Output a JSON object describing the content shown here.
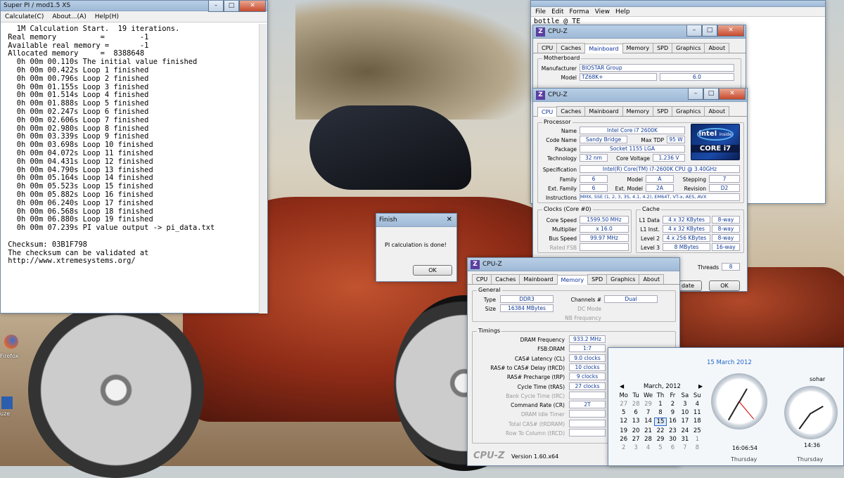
{
  "superpi": {
    "title": "Super PI / mod1.5 XS",
    "menu": [
      "Calculate(C)",
      "About...(A)",
      "Help(H)"
    ],
    "lines": [
      "   1M Calculation Start.  19 iterations.",
      " Real memory          =        -1",
      " Available real memory =       -1",
      " Allocated memory     =  8388648",
      "   0h 00m 00.110s The initial value finished",
      "   0h 00m 00.422s Loop 1 finished",
      "   0h 00m 00.796s Loop 2 finished",
      "   0h 00m 01.155s Loop 3 finished",
      "   0h 00m 01.514s Loop 4 finished",
      "   0h 00m 01.888s Loop 5 finished",
      "   0h 00m 02.247s Loop 6 finished",
      "   0h 00m 02.606s Loop 7 finished",
      "   0h 00m 02.980s Loop 8 finished",
      "   0h 00m 03.339s Loop 9 finished",
      "   0h 00m 03.698s Loop 10 finished",
      "   0h 00m 04.072s Loop 11 finished",
      "   0h 00m 04.431s Loop 12 finished",
      "   0h 00m 04.790s Loop 13 finished",
      "   0h 00m 05.164s Loop 14 finished",
      "   0h 00m 05.523s Loop 15 finished",
      "   0h 00m 05.882s Loop 16 finished",
      "   0h 00m 06.240s Loop 17 finished",
      "   0h 00m 06.568s Loop 18 finished",
      "   0h 00m 06.880s Loop 19 finished",
      "   0h 00m 07.239s PI value output -> pi_data.txt",
      "",
      " Checksum: 03B1F798",
      " The checksum can be validated at",
      " http://www.xtremesystems.org/"
    ]
  },
  "finish": {
    "title": "Finish",
    "message": "PI calculation is done!",
    "ok": "OK"
  },
  "notepad": {
    "menu": [
      "File",
      "Edit",
      "Forma",
      "View",
      "Help"
    ],
    "text": "bottle @ TE"
  },
  "cpuz_mb": {
    "title": "CPU-Z",
    "tabs": [
      "CPU",
      "Caches",
      "Mainboard",
      "Memory",
      "SPD",
      "Graphics",
      "About"
    ],
    "group": "Motherboard",
    "manufacturer_label": "Manufacturer",
    "manufacturer": "BIOSTAR Group",
    "model_label": "Model",
    "model": "TZ68K+",
    "model_rev": "6.0"
  },
  "cpuz_cpu": {
    "title": "CPU-Z",
    "tabs": [
      "CPU",
      "Caches",
      "Mainboard",
      "Memory",
      "SPD",
      "Graphics",
      "About"
    ],
    "processor": "Processor",
    "name_label": "Name",
    "name": "Intel Core i7 2600K",
    "codename_label": "Code Name",
    "codename": "Sandy Bridge",
    "tdp_label": "Max TDP",
    "tdp": "95 W",
    "package_label": "Package",
    "package": "Socket 1155 LGA",
    "tech_label": "Technology",
    "tech": "32 nm",
    "voltage_label": "Core Voltage",
    "voltage": "1.236 V",
    "spec_label": "Specification",
    "spec": "Intel(R) Core(TM) i7-2600K CPU @ 3.40GHz",
    "family_label": "Family",
    "family": "6",
    "model_label": "Model",
    "model": "A",
    "stepping_label": "Stepping",
    "stepping": "7",
    "extfamily_label": "Ext. Family",
    "extfamily": "6",
    "extmodel_label": "Ext. Model",
    "extmodel": "2A",
    "revision_label": "Revision",
    "revision": "D2",
    "instr_label": "Instructions",
    "instr": "MMX, SSE (1, 2, 3, 3S, 4.1, 4.2), EM64T, VT-x, AES, AVX",
    "clocks": "Clocks (Core #0)",
    "corespeed_label": "Core Speed",
    "corespeed": "1599.50 MHz",
    "mult_label": "Multiplier",
    "mult": "x 16.0",
    "bus_label": "Bus Speed",
    "bus": "99.97 MHz",
    "fsb_label": "Rated FSB",
    "cache": "Cache",
    "l1d_label": "L1 Data",
    "l1d": "4 x 32 KBytes",
    "l1d_way": "8-way",
    "l1i_label": "L1 Inst.",
    "l1i": "4 x 32 KBytes",
    "l1i_way": "8-way",
    "l2_label": "Level 2",
    "l2": "4 x 256 KBytes",
    "l2_way": "8-way",
    "l3_label": "Level 3",
    "l3": "8 MBytes",
    "l3_way": "16-way",
    "threads_label": "Threads",
    "threads": "8",
    "validate": "date",
    "ok": "OK",
    "logo_brand": "intel",
    "logo_inside": "inside",
    "logo_product": "CORE i7"
  },
  "cpuz_mem": {
    "title": "CPU-Z",
    "tabs": [
      "CPU",
      "Caches",
      "Mainboard",
      "Memory",
      "SPD",
      "Graphics",
      "About"
    ],
    "general": "General",
    "type_label": "Type",
    "type": "DDR3",
    "size_label": "Size",
    "size": "16384 MBytes",
    "channels_label": "Channels #",
    "channels": "Dual",
    "dcmode_label": "DC Mode",
    "nbfreq_label": "NB Frequency",
    "timings": "Timings",
    "rows": [
      {
        "label": "DRAM Frequency",
        "value": "933.2 MHz",
        "gray": false
      },
      {
        "label": "FSB:DRAM",
        "value": "1:7",
        "gray": false
      },
      {
        "label": "CAS# Latency (CL)",
        "value": "9.0 clocks",
        "gray": false
      },
      {
        "label": "RAS# to CAS# Delay (tRCD)",
        "value": "10 clocks",
        "gray": false
      },
      {
        "label": "RAS# Precharge (tRP)",
        "value": "9 clocks",
        "gray": false
      },
      {
        "label": "Cycle Time (tRAS)",
        "value": "27 clocks",
        "gray": false
      },
      {
        "label": "Bank Cycle Time (tRC)",
        "value": "",
        "gray": true
      },
      {
        "label": "Command Rate (CR)",
        "value": "2T",
        "gray": false
      },
      {
        "label": "DRAM Idle Timer",
        "value": "",
        "gray": true
      },
      {
        "label": "Total CAS# (tRDRAM)",
        "value": "",
        "gray": true
      },
      {
        "label": "Row To Column (tRCD)",
        "value": "",
        "gray": true
      }
    ],
    "footer_logo": "CPU-Z",
    "version": "Version 1.60.x64"
  },
  "calendar": {
    "date_link": "15 March 2012",
    "month": "March, 2012",
    "weekdays": [
      "Mo",
      "Tu",
      "We",
      "Th",
      "Fr",
      "Sa",
      "Su"
    ],
    "days": [
      "27",
      "28",
      "29",
      "1",
      "2",
      "3",
      "4",
      "5",
      "6",
      "7",
      "8",
      "9",
      "10",
      "11",
      "12",
      "13",
      "14",
      "15",
      "16",
      "17",
      "18",
      "19",
      "20",
      "21",
      "22",
      "23",
      "24",
      "25",
      "26",
      "27",
      "28",
      "29",
      "30",
      "31",
      "1",
      "2",
      "3",
      "4",
      "5",
      "6",
      "7",
      "8"
    ],
    "clock1_time": "16:06:54",
    "clock1_day": "Thursday",
    "clock2_name": "sohar",
    "clock2_time": "14:36",
    "clock2_day": "Thursday"
  },
  "desktop": {
    "icon1": "Firefox",
    "icon2": "uze"
  }
}
